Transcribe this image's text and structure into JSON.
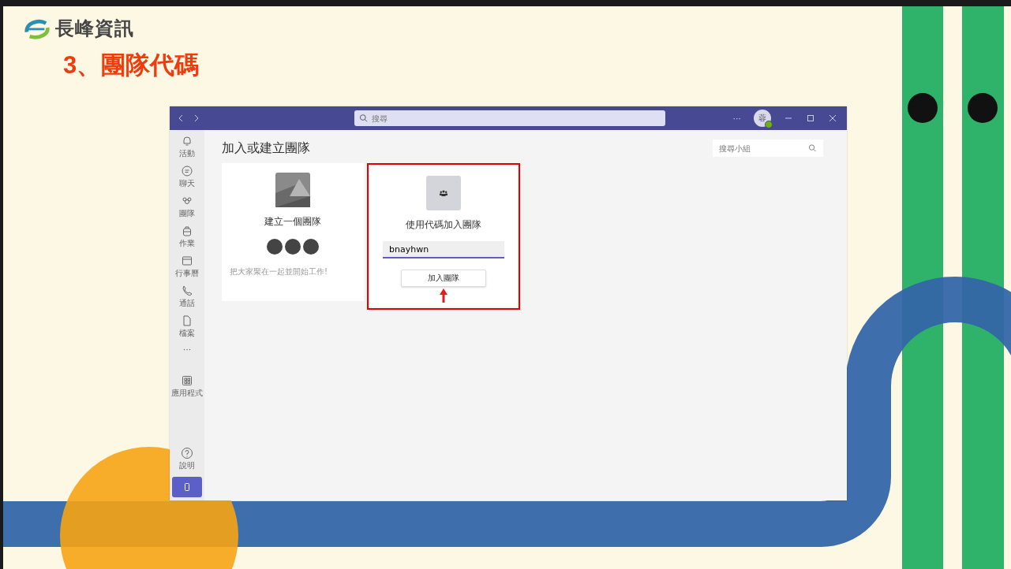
{
  "slide": {
    "brand": "長峰資訊",
    "heading": "3、團隊代碼"
  },
  "window": {
    "search_placeholder": "搜尋",
    "more": "···",
    "avatar_initial": "蓉",
    "avatar_online": true
  },
  "sidebar": {
    "items": [
      {
        "kind": "bell",
        "label": "活動"
      },
      {
        "kind": "chat",
        "label": "聊天"
      },
      {
        "kind": "teams",
        "label": "團隊"
      },
      {
        "kind": "bag",
        "label": "作業"
      },
      {
        "kind": "calendar",
        "label": "行事曆"
      },
      {
        "kind": "phone",
        "label": "通話"
      },
      {
        "kind": "file",
        "label": "檔案"
      },
      {
        "kind": "more",
        "label": "···"
      },
      {
        "kind": "apps",
        "label": "應用程式"
      }
    ],
    "help": {
      "label": "說明"
    }
  },
  "page": {
    "title": "加入或建立團隊",
    "search_placeholder": "搜尋小組",
    "create_card": {
      "title": "建立一個團隊",
      "caption": "把大家聚在一起並開始工作!"
    },
    "join_card": {
      "title": "使用代碼加入團隊",
      "code": "bnayhwn",
      "button": "加入團隊",
      "highlighted": true
    }
  }
}
